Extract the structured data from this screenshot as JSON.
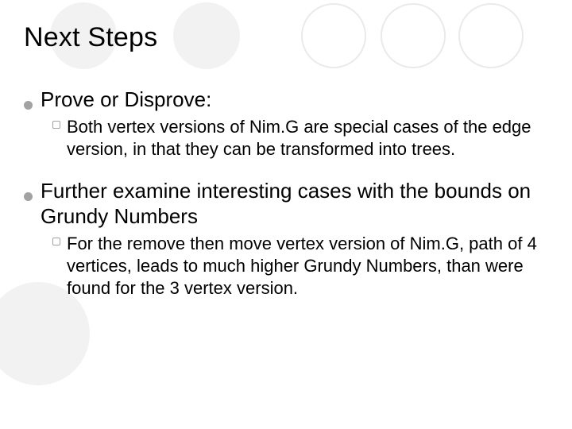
{
  "slide": {
    "title": "Next Steps",
    "items": [
      {
        "head": "Prove or Disprove:",
        "sub": "Both vertex versions of Nim.G are special cases of the edge version, in that they can be transformed into trees."
      },
      {
        "head": "Further examine interesting cases with the bounds on Grundy Numbers",
        "sub": "For the remove then move vertex version of Nim.G, path of 4 vertices, leads to much higher Grundy Numbers, than were found for the 3 vertex version."
      }
    ]
  },
  "decor": {
    "circle_fill": "#f2f2f2",
    "circle_stroke": "#e6e6e6"
  }
}
